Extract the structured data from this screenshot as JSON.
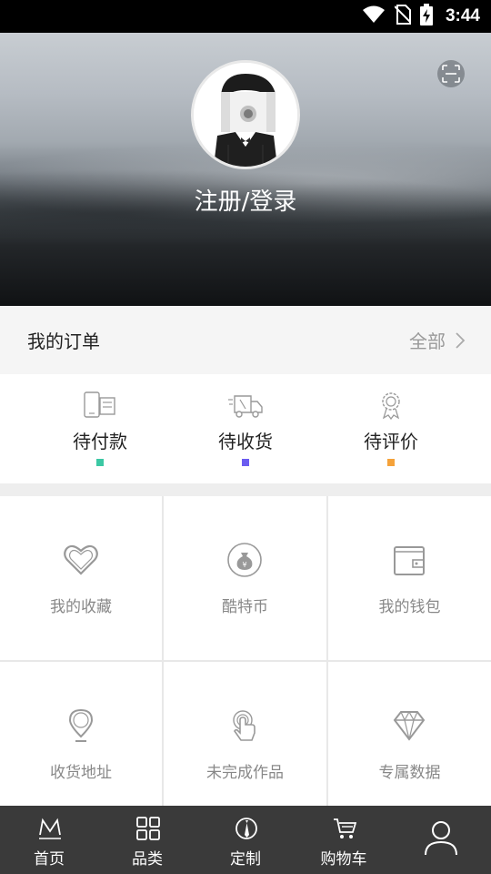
{
  "status_bar": {
    "time": "3:44",
    "icons": [
      "wifi-icon",
      "no-sim-icon",
      "battery-charging-icon"
    ]
  },
  "profile": {
    "login_label": "注册/登录",
    "scan_icon": "scan-icon",
    "avatar": "default-avatar"
  },
  "orders": {
    "title": "我的订单",
    "view_all_label": "全部",
    "items": [
      {
        "label": "待付款",
        "icon": "phone-payment-icon",
        "color": "#3cc8a4"
      },
      {
        "label": "待收货",
        "icon": "delivery-truck-icon",
        "color": "#6b5cf0"
      },
      {
        "label": "待评价",
        "icon": "award-badge-icon",
        "color": "#f5a23a"
      }
    ]
  },
  "features": [
    {
      "label": "我的收藏",
      "icon": "heart-icon"
    },
    {
      "label": "酷特币",
      "icon": "coin-bag-icon"
    },
    {
      "label": "我的钱包",
      "icon": "wallet-icon"
    },
    {
      "label": "收货地址",
      "icon": "location-pin-icon"
    },
    {
      "label": "未完成作品",
      "icon": "touch-hand-icon"
    },
    {
      "label": "专属数据",
      "icon": "diamond-icon"
    }
  ],
  "tab_bar": {
    "tabs": [
      {
        "label": "首页",
        "icon": "m-logo-icon"
      },
      {
        "label": "品类",
        "icon": "grid-icon"
      },
      {
        "label": "定制",
        "icon": "tie-icon"
      },
      {
        "label": "购物车",
        "icon": "cart-icon"
      },
      {
        "label": "",
        "icon": "user-icon"
      }
    ],
    "active_index": 4
  },
  "colors": {
    "tab_bar_bg": "#3a3a3a",
    "section_bg": "#f5f5f5",
    "muted_text": "#888888"
  }
}
